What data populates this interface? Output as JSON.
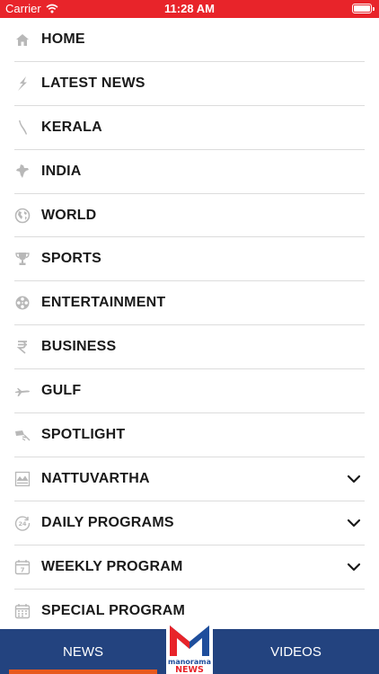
{
  "status_bar": {
    "carrier": "Carrier",
    "time": "11:28 AM"
  },
  "menu": {
    "items": [
      {
        "label": "HOME",
        "icon": "home-icon",
        "expandable": false
      },
      {
        "label": "LATEST NEWS",
        "icon": "lightning-icon",
        "expandable": false
      },
      {
        "label": "KERALA",
        "icon": "kerala-map-icon",
        "expandable": false
      },
      {
        "label": "INDIA",
        "icon": "india-map-icon",
        "expandable": false
      },
      {
        "label": "WORLD",
        "icon": "globe-icon",
        "expandable": false
      },
      {
        "label": "SPORTS",
        "icon": "trophy-icon",
        "expandable": false
      },
      {
        "label": "ENTERTAINMENT",
        "icon": "film-reel-icon",
        "expandable": false
      },
      {
        "label": "BUSINESS",
        "icon": "rupee-icon",
        "expandable": false
      },
      {
        "label": "GULF",
        "icon": "airplane-icon",
        "expandable": false
      },
      {
        "label": "SPOTLIGHT",
        "icon": "spotlight-icon",
        "expandable": false
      },
      {
        "label": "NATTUVARTHA",
        "icon": "news-image-icon",
        "expandable": true
      },
      {
        "label": "DAILY PROGRAMS",
        "icon": "24-hour-icon",
        "expandable": true
      },
      {
        "label": "WEEKLY PROGRAM",
        "icon": "calendar-7-icon",
        "expandable": true
      },
      {
        "label": "SPECIAL PROGRAM",
        "icon": "calendar-grid-icon",
        "expandable": false
      }
    ]
  },
  "bottom_nav": {
    "news_label": "NEWS",
    "videos_label": "VIDEOS",
    "logo_text_top": "manorama",
    "logo_text_bottom": "NEWS"
  },
  "colors": {
    "status_bar": "#e8242a",
    "bottom_bar": "#23437f",
    "active_tab_underline": "#e85a1e",
    "logo_red": "#e8242a",
    "logo_blue": "#1f4e9c"
  }
}
